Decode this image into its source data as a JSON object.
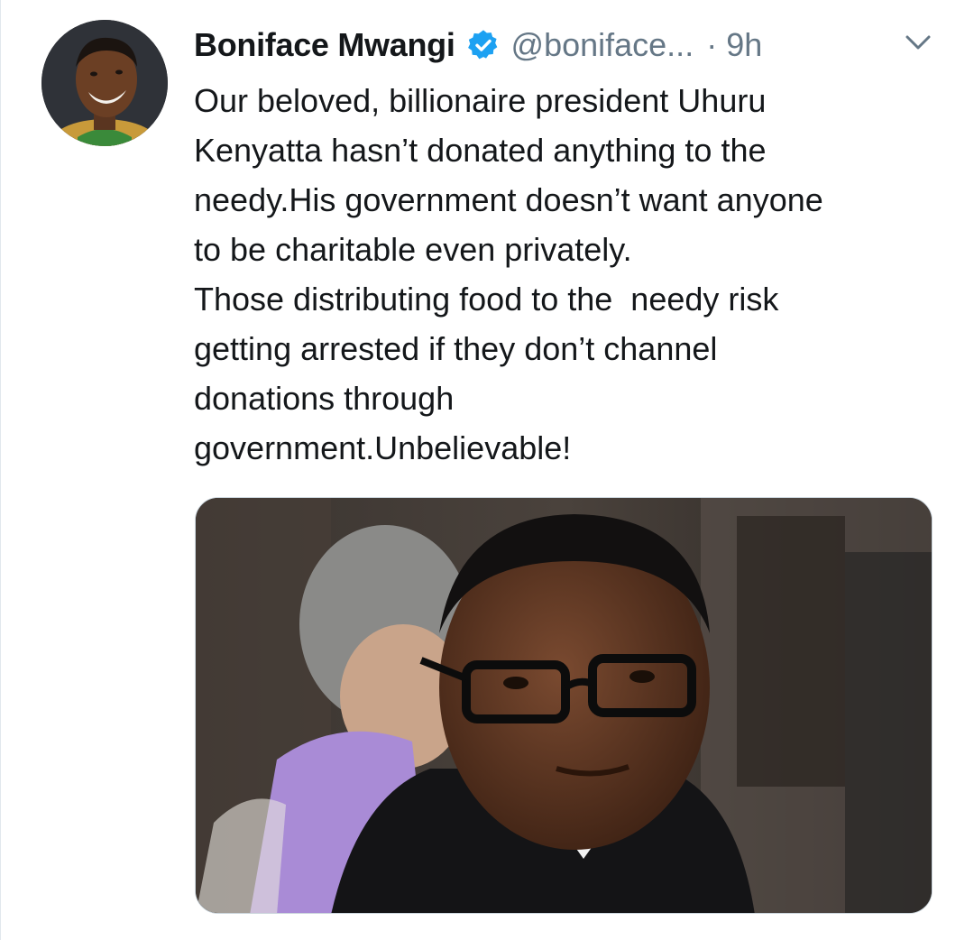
{
  "tweet": {
    "author": {
      "display_name": "Boniface Mwangi",
      "handle": "@boniface...",
      "verified": true,
      "avatar_icon": "profile-photo"
    },
    "separator": "·",
    "time": "9h",
    "menu_icon": "chevron-down-icon",
    "text_lines": [
      "Our beloved, billionaire president Uhuru",
      "Kenyatta hasn’t donated anything to the",
      "needy.His government doesn’t want anyone",
      "to be charitable even privately.",
      "Those distributing food to the  needy risk",
      "getting arrested if they don’t channel",
      "donations through",
      "government.Unbelievable!"
    ],
    "media": {
      "kind": "photo"
    }
  },
  "colors": {
    "text": "#14171a",
    "secondary": "#657786",
    "verified_blue": "#1da1f2",
    "border": "#ccd6dd"
  }
}
